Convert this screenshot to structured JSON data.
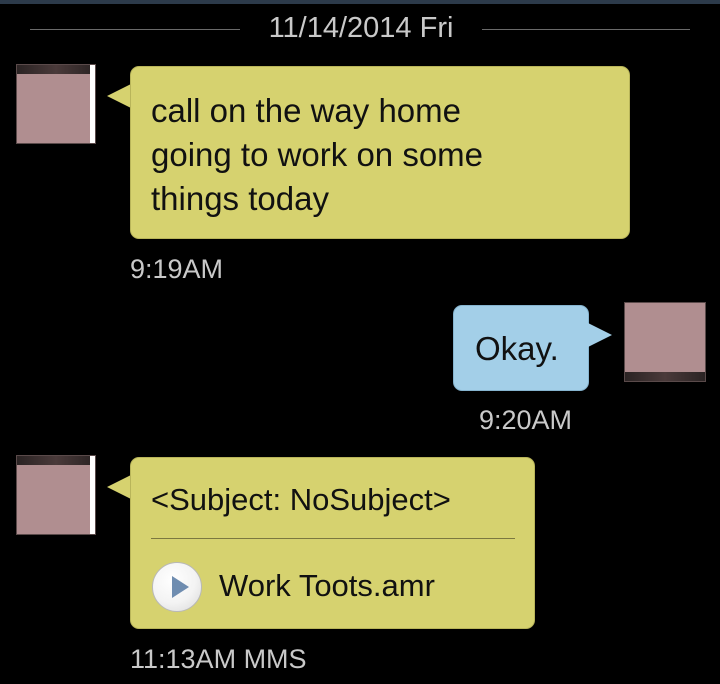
{
  "date_header": "11/14/2014 Fri",
  "messages": [
    {
      "direction": "incoming",
      "text": "call on the way home\ngoing to work on some\nthings today",
      "time": "9:19AM"
    },
    {
      "direction": "outgoing",
      "text": "Okay.",
      "time": "9:20AM"
    },
    {
      "direction": "incoming",
      "subject": "<Subject: NoSubject>",
      "attachment": {
        "icon": "play-icon",
        "name": "Work Toots.amr"
      },
      "time": "11:13AM MMS"
    }
  ],
  "colors": {
    "background": "#000000",
    "incoming_bubble": "#d6d26f",
    "outgoing_bubble": "#a3cfe8",
    "timestamp": "#c9c9c9",
    "avatar_redaction": "#b08e90"
  }
}
